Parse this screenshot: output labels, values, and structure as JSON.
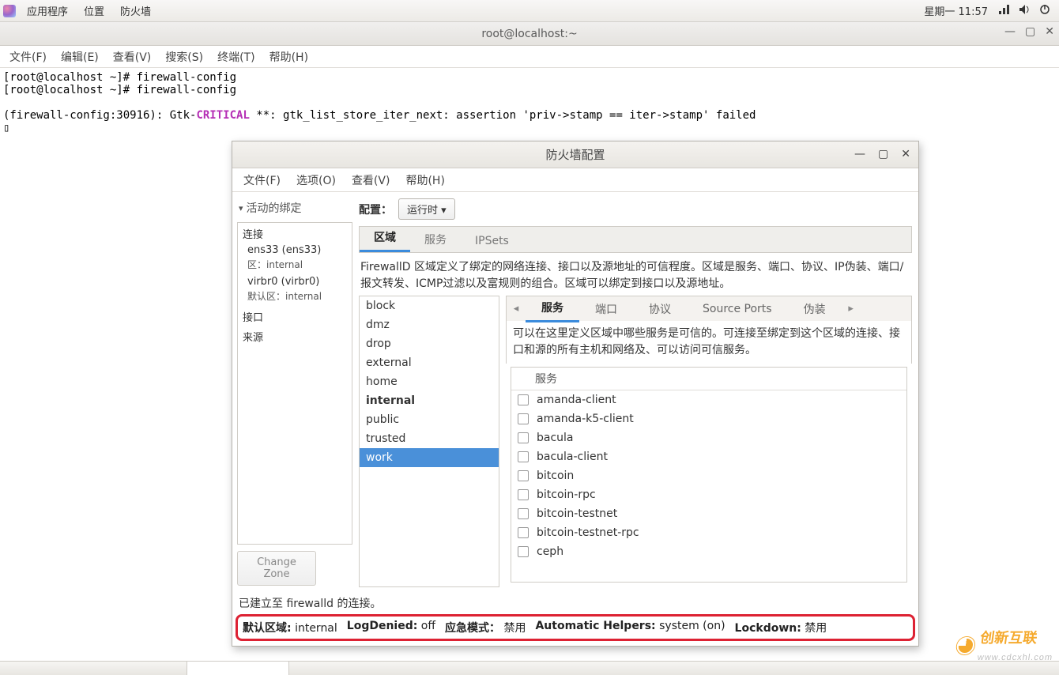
{
  "panel": {
    "menus": [
      "应用程序",
      "位置",
      "防火墙"
    ],
    "clock": "星期一 11:57"
  },
  "terminal": {
    "title": "root@localhost:~",
    "menus": [
      "文件(F)",
      "编辑(E)",
      "查看(V)",
      "搜索(S)",
      "终端(T)",
      "帮助(H)"
    ],
    "line1": "[root@localhost ~]# firewall-config",
    "line2": "[root@localhost ~]# firewall-config",
    "line3_pre": "(firewall-config:30916): Gtk-",
    "line3_crit": "CRITICAL",
    "line3_post": " **: gtk_list_store_iter_next: assertion 'priv->stamp == iter->stamp' failed"
  },
  "fwin": {
    "title": "防火墙配置",
    "menus": [
      "文件(F)",
      "选项(O)",
      "查看(V)",
      "帮助(H)"
    ],
    "bindings_label": "活动的绑定",
    "config_label": "配置：",
    "config_value": "运行时 ▾",
    "conn": {
      "connections": "连接",
      "iface1": "ens33 (ens33)",
      "iface1_zone": "区：internal",
      "iface2": "virbr0 (virbr0)",
      "iface2_zone": "默认区：internal",
      "interfaces": "接口",
      "sources": "来源"
    },
    "change_zone": "Change Zone",
    "big_tabs": [
      "区域",
      "服务",
      "IPSets"
    ],
    "zone_desc": "FirewallD 区域定义了绑定的网络连接、接口以及源地址的可信程度。区域是服务、端口、协议、IP伪装、端口/报文转发、ICMP过滤以及富规则的组合。区域可以绑定到接口以及源地址。",
    "zones": [
      "block",
      "dmz",
      "drop",
      "external",
      "home",
      "internal",
      "public",
      "trusted",
      "work"
    ],
    "selected_zone": "work",
    "bold_zone": "internal",
    "inner_tabs": [
      "服务",
      "端口",
      "协议",
      "Source Ports",
      "伪装"
    ],
    "svc_desc": "可以在这里定义区域中哪些服务是可信的。可连接至绑定到这个区域的连接、接口和源的所有主机和网络及、可以访问可信服务。",
    "svc_header": "服务",
    "services": [
      "amanda-client",
      "amanda-k5-client",
      "bacula",
      "bacula-client",
      "bitcoin",
      "bitcoin-rpc",
      "bitcoin-testnet",
      "bitcoin-testnet-rpc",
      "ceph"
    ],
    "status1": "已建立至 firewalld 的连接。",
    "status2": {
      "default_zone_label": "默认区域:",
      "default_zone": "internal",
      "logdenied_label": "LogDenied:",
      "logdenied": "off",
      "panic_label": "应急模式：",
      "panic": "禁用",
      "auto_label": "Automatic Helpers:",
      "auto": "system (on)",
      "lockdown_label": "Lockdown:",
      "lockdown": "禁用"
    }
  },
  "watermark": {
    "text": "创新互联",
    "sub": "www.cdcxhl.com"
  }
}
